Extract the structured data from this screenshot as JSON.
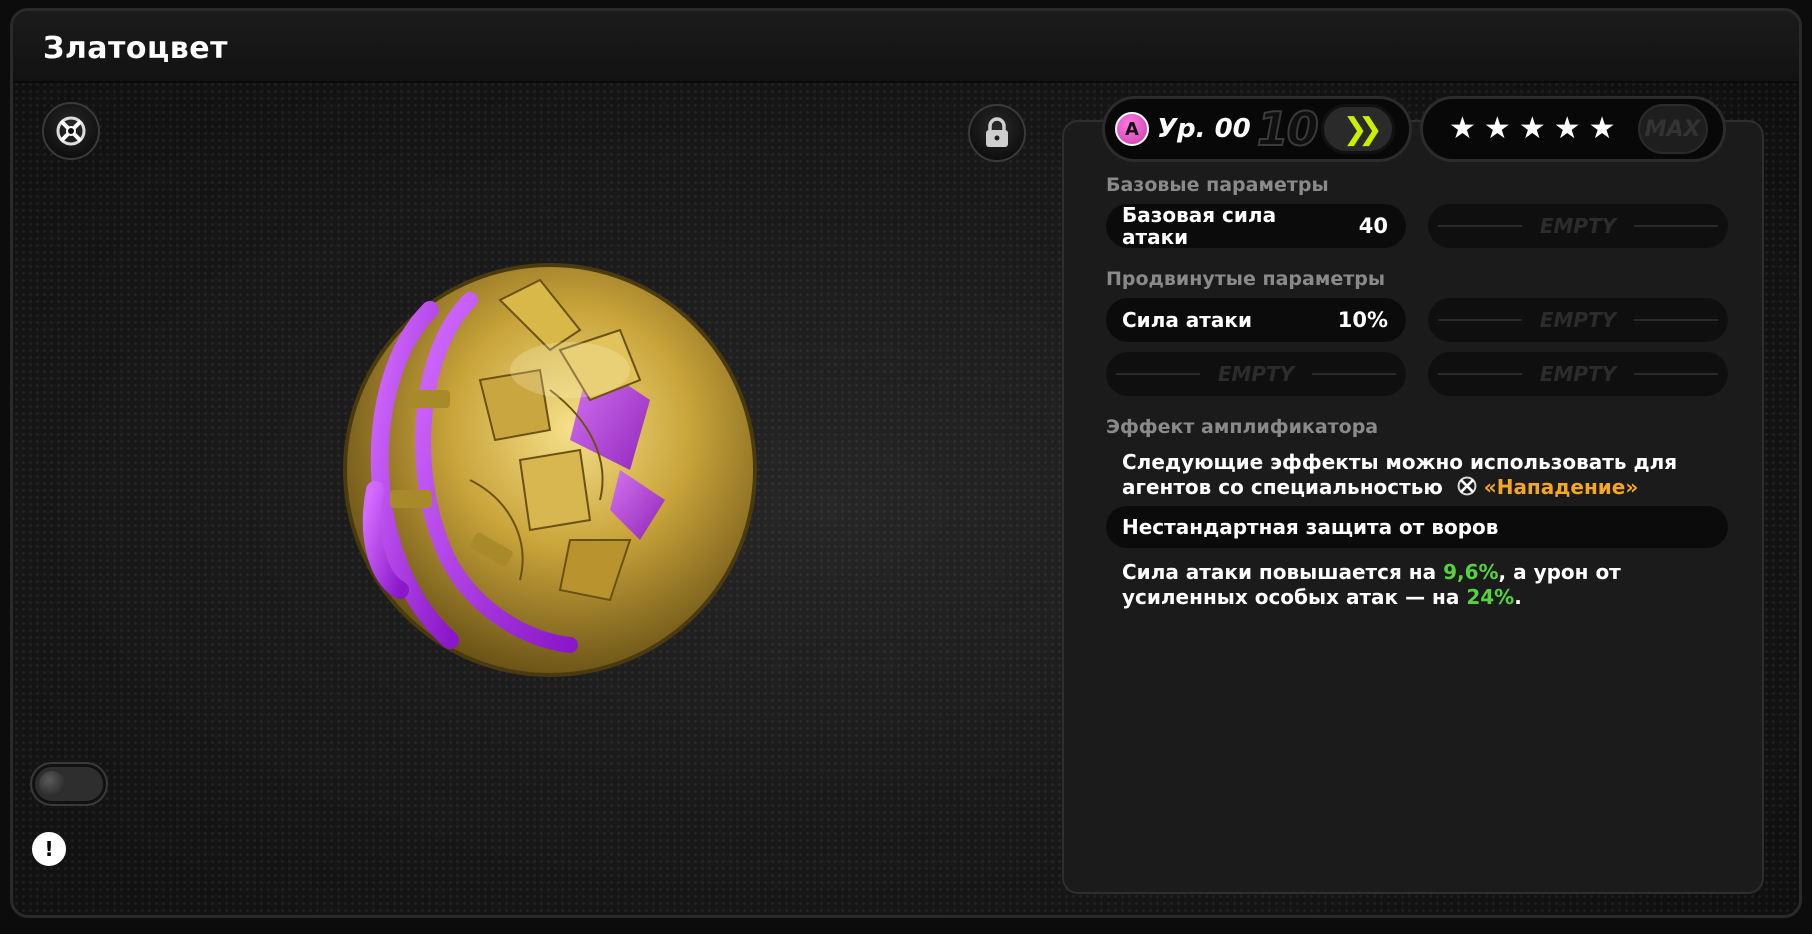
{
  "title": "Златоцвет",
  "level": {
    "rank": "A",
    "label": "Ур. 00",
    "max": "10",
    "upgrade_icon": "double-chevron-right-icon"
  },
  "rarity": {
    "stars": 5,
    "max_label": "MAX"
  },
  "base_params": {
    "label": "Базовые параметры",
    "items": [
      {
        "name": "Базовая сила атаки",
        "value": "40"
      }
    ],
    "empty_label": "EMPTY"
  },
  "advanced_params": {
    "label": "Продвинутые параметры",
    "items": [
      {
        "name": "Сила атаки",
        "value": "10%"
      }
    ],
    "empty_label": "EMPTY"
  },
  "effect": {
    "label": "Эффект амплификатора",
    "intro_line1": "Следующие эффекты можно использовать для",
    "intro_line2_prefix": "агентов со специальностью",
    "specialty": "«Нападение»",
    "effect_name": "Нестандартная защита от воров",
    "desc_part1": "Сила атаки повышается на ",
    "desc_val1": "9,6%",
    "desc_part2": ", а урон от",
    "desc_part3": "усиленных особых атак — на ",
    "desc_val2": "24%",
    "desc_part4": "."
  },
  "colors": {
    "accent_orange": "#f5a623",
    "accent_green": "#56d23c",
    "rank_pink": "#ff7be6",
    "upgrade_lime": "#c8f000",
    "engine_gold": "#c9a43a",
    "engine_purple": "#a62be0"
  },
  "icons": {
    "specialty": "attack-specialty-icon",
    "lock": "lock-icon",
    "info": "info-icon"
  }
}
